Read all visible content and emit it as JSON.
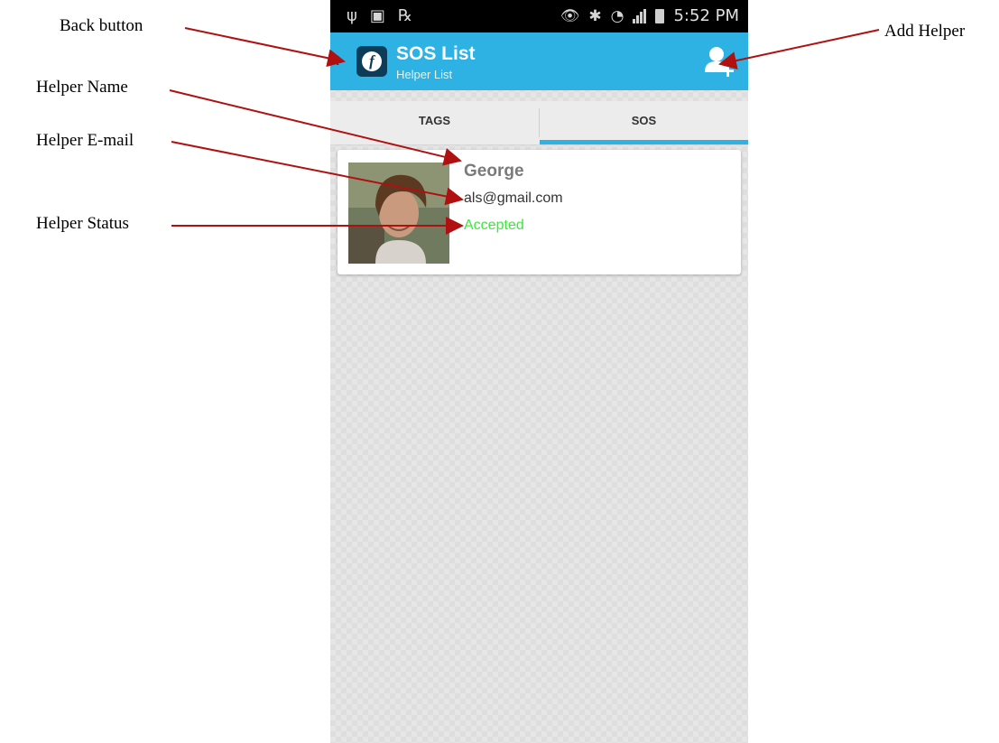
{
  "callouts": {
    "back_button": "Back button",
    "add_helper": "Add Helper",
    "helper_name": "Helper Name",
    "helper_email": "Helper E-mail",
    "helper_status": "Helper Status"
  },
  "status_bar": {
    "time": "5:52 PM",
    "left_icons": [
      "usb-icon",
      "image-icon",
      "prescription-icon"
    ],
    "right_icons": [
      "eye-icon",
      "bluetooth-icon",
      "wifi-icon",
      "signal-icon",
      "battery-icon"
    ]
  },
  "action_bar": {
    "title": "SOS List",
    "subtitle": "Helper List",
    "back_icon": "chevron-left-icon",
    "logo_letter": "f",
    "add_helper_icon": "add-user-icon",
    "color": "#2eb1e3"
  },
  "tabs": [
    {
      "label": "TAGS",
      "selected": false
    },
    {
      "label": "SOS",
      "selected": true
    }
  ],
  "helpers": [
    {
      "name": "George",
      "email": "als@gmail.com",
      "status": "Accepted",
      "status_color": "#3ee63e"
    }
  ]
}
